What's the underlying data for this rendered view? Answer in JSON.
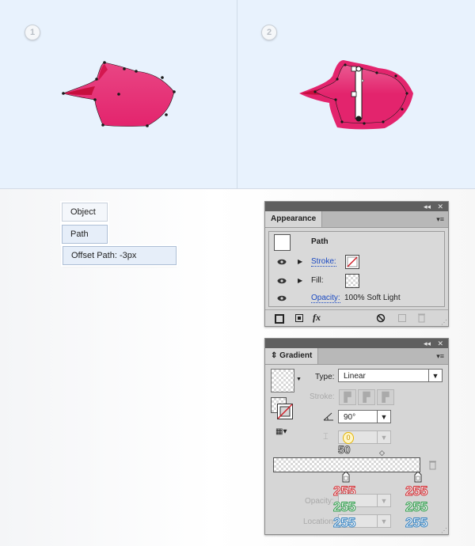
{
  "steps": {
    "step1": "1",
    "step2": "2"
  },
  "context_menu": {
    "object": "Object",
    "path": "Path",
    "offset": "Offset Path: -3px"
  },
  "appearance": {
    "tab": "Appearance",
    "header": "Path",
    "stroke_label": "Stroke:",
    "fill_label": "Fill:",
    "opacity_label": "Opacity:",
    "opacity_value": "100% Soft Light",
    "collapse": "◂◂",
    "close": "✕",
    "menu": "▾≡",
    "fx": "fx"
  },
  "gradient": {
    "tab": "Gradient",
    "type_label": "Type:",
    "type_value": "Linear",
    "stroke_label": "Stroke:",
    "angle_value": "90°",
    "aspect_value": "0",
    "midpoint_value": "50",
    "opacity_label": "Opacity:",
    "location_label": "Location:",
    "left_stop": {
      "r": "255",
      "g": "255",
      "b": "255"
    },
    "right_stop": {
      "r": "255",
      "g": "255",
      "b": "255"
    }
  },
  "colors": {
    "shape_fill": "#e3246d",
    "shape_highlight": "#c70f3e",
    "bg_top": "#e8f2fd"
  }
}
